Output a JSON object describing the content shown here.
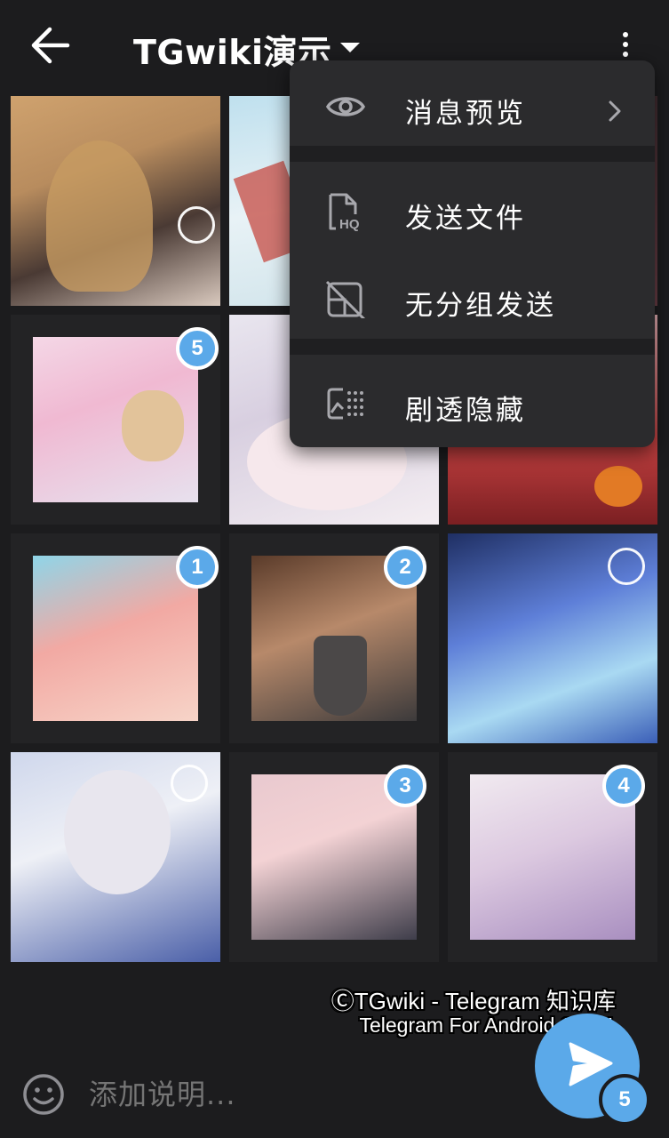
{
  "header": {
    "title": "TGwiki演示",
    "back_icon": "arrow-left-icon",
    "more_icon": "more-vert-icon"
  },
  "menu": {
    "items": [
      {
        "label": "消息预览",
        "icon": "eye-icon",
        "has_submenu": true
      },
      {
        "label": "发送文件",
        "icon": "file-hq-icon"
      },
      {
        "label": "无分组发送",
        "icon": "ungroup-icon"
      },
      {
        "label": "剧透隐藏",
        "icon": "spoiler-icon"
      }
    ]
  },
  "gallery": {
    "photos": [
      {
        "selected": false,
        "order": ""
      },
      {
        "selected": false,
        "order": ""
      },
      {
        "selected": false,
        "order": ""
      },
      {
        "selected": true,
        "order": "5"
      },
      {
        "selected": false,
        "order": ""
      },
      {
        "selected": false,
        "order": ""
      },
      {
        "selected": true,
        "order": "1"
      },
      {
        "selected": true,
        "order": "2"
      },
      {
        "selected": false,
        "order": ""
      },
      {
        "selected": false,
        "order": ""
      },
      {
        "selected": true,
        "order": "3"
      },
      {
        "selected": true,
        "order": "4"
      }
    ]
  },
  "composer": {
    "placeholder": "添加说明...",
    "emoji_icon": "emoji-icon",
    "send_icon": "send-icon",
    "selected_count": "5"
  },
  "watermark": {
    "line1": "ⒸTGwiki - Telegram 知识库",
    "line2": "Telegram For Android 11.3.1"
  },
  "colors": {
    "background": "#1c1c1e",
    "menu_background": "#2b2b2d",
    "accent": "#5ba9e9"
  }
}
